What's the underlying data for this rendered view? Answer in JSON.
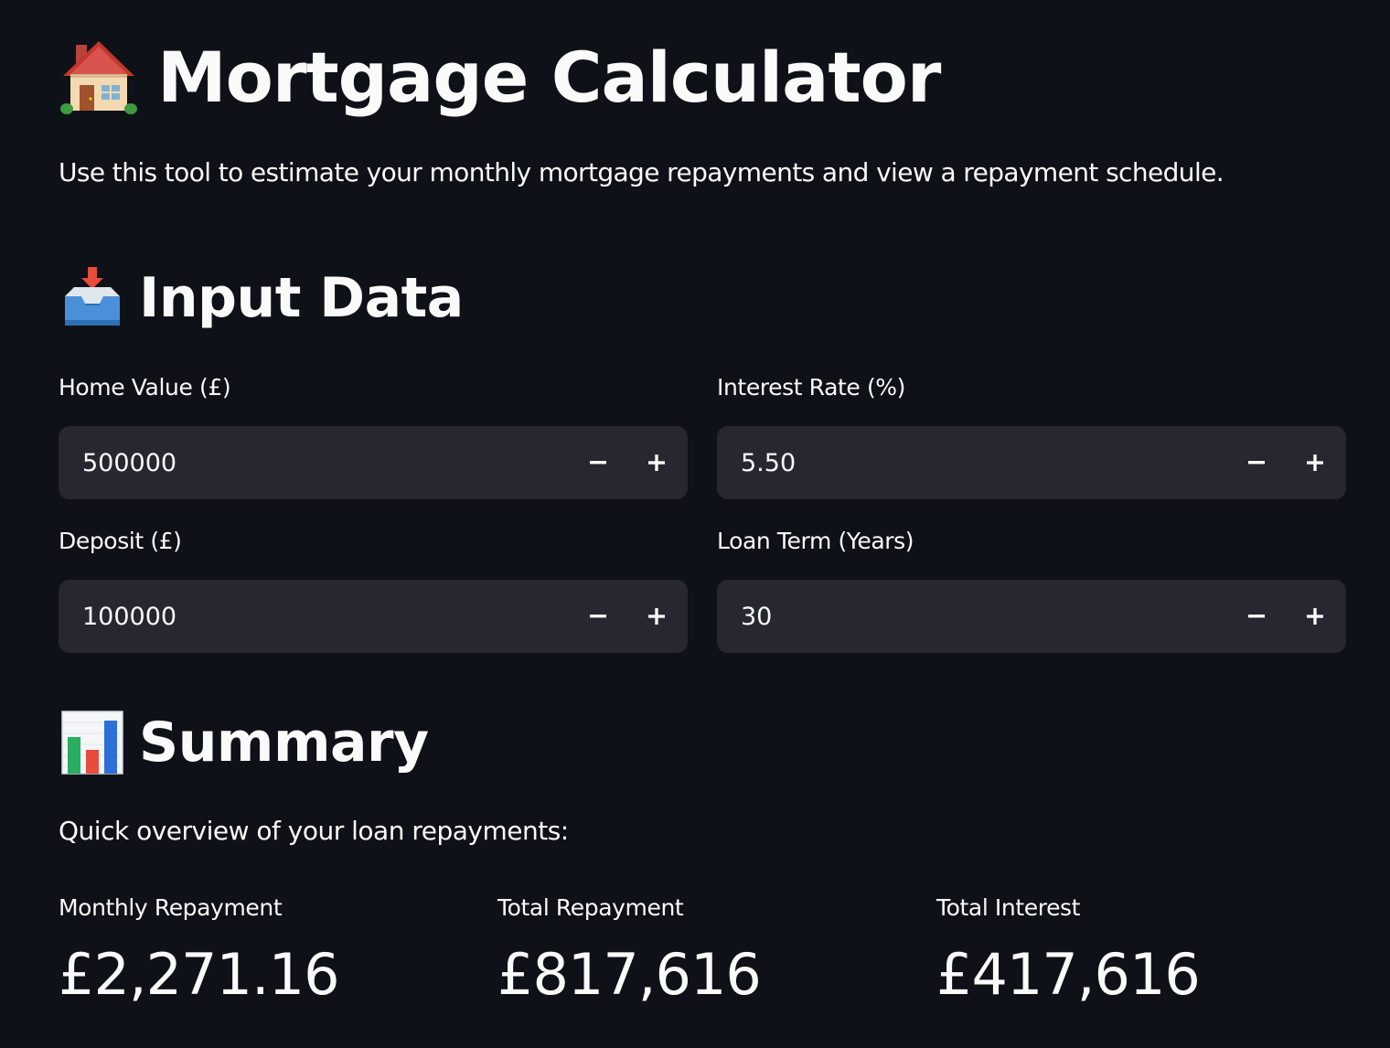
{
  "header": {
    "title": "Mortgage Calculator",
    "title_icon": "house-emoji-icon",
    "description": "Use this tool to estimate your monthly mortgage repayments and view a repayment schedule."
  },
  "input_section": {
    "heading": "Input Data",
    "heading_icon": "inbox-tray-emoji-icon",
    "fields": {
      "home_value": {
        "label": "Home Value (£)",
        "value": "500000"
      },
      "interest_rate": {
        "label": "Interest Rate (%)",
        "value": "5.50"
      },
      "deposit": {
        "label": "Deposit (£)",
        "value": "100000"
      },
      "loan_term": {
        "label": "Loan Term (Years)",
        "value": "30"
      }
    }
  },
  "summary_section": {
    "heading": "Summary",
    "heading_icon": "bar-chart-emoji-icon",
    "description": "Quick overview of your loan repayments:",
    "metrics": {
      "monthly": {
        "label": "Monthly Repayment",
        "value": "£2,271.16"
      },
      "total": {
        "label": "Total Repayment",
        "value": "£817,616"
      },
      "interest": {
        "label": "Total Interest",
        "value": "£417,616"
      }
    }
  },
  "colors": {
    "background": "#0e1117",
    "input_background": "#262730",
    "text": "#fafafa"
  }
}
